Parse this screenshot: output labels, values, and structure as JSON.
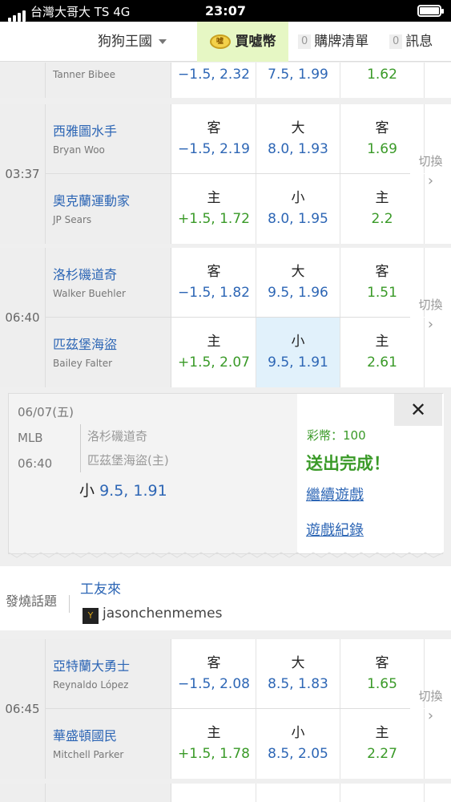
{
  "status": {
    "carrier": "台灣大哥大 TS   4G",
    "time": "23:07"
  },
  "nav": {
    "kingdom": "狗狗王國",
    "buy_label": "買噓幣",
    "coin_glyph": "噓",
    "cart_count": "0",
    "cart_label": "購牌清單",
    "msg_count": "0",
    "msg_label": "訊息"
  },
  "partial_row": {
    "pitcher": "Tanner Bibee",
    "spread": "−1.5, 2.32",
    "total": "7.5, 1.99",
    "ml": "1.62"
  },
  "games": [
    {
      "time": "03:37",
      "switch": "切換",
      "away": {
        "name": "西雅圖水手",
        "pitcher": "Bryan Woo",
        "spread_label": "客",
        "spread": "−1.5, 2.19",
        "total_label": "大",
        "total": "8.0, 1.93",
        "ml_label": "客",
        "ml": "1.69"
      },
      "home": {
        "name": "奧克蘭運動家",
        "pitcher": "JP Sears",
        "spread_label": "主",
        "spread": "+1.5, 1.72",
        "total_label": "小",
        "total": "8.0, 1.95",
        "ml_label": "主",
        "ml": "2.2"
      }
    },
    {
      "time": "06:40",
      "switch": "切換",
      "away": {
        "name": "洛杉磯道奇",
        "pitcher": "Walker Buehler",
        "spread_label": "客",
        "spread": "−1.5, 1.82",
        "total_label": "大",
        "total": "9.5, 1.96",
        "ml_label": "客",
        "ml": "1.51"
      },
      "home": {
        "name": "匹茲堡海盜",
        "pitcher": "Bailey Falter",
        "spread_label": "主",
        "spread": "+1.5, 2.07",
        "total_label": "小",
        "total": "9.5, 1.91",
        "ml_label": "主",
        "ml": "2.61"
      }
    },
    {
      "time": "06:45",
      "switch": "切換",
      "away": {
        "name": "亞特蘭大勇士",
        "pitcher": "Reynaldo López",
        "spread_label": "客",
        "spread": "−1.5, 2.08",
        "total_label": "大",
        "total": "8.5, 1.83",
        "ml_label": "客",
        "ml": "1.65"
      },
      "home": {
        "name": "華盛頓國民",
        "pitcher": "Mitchell Parker",
        "spread_label": "主",
        "spread": "+1.5, 1.78",
        "total_label": "小",
        "total": "8.5, 2.05",
        "ml_label": "主",
        "ml": "2.27"
      }
    }
  ],
  "confirmation": {
    "date": "06/07(五)",
    "league": "MLB",
    "time": "06:40",
    "team1": "洛杉磯道奇",
    "team2": "匹茲堡海盜(主)",
    "pick_label": "小",
    "pick_value": "9.5, 1.91",
    "coins": "彩幣：100",
    "done": "送出完成！",
    "continue": "繼續遊戲",
    "history": "遊戲紀錄",
    "close": "✕"
  },
  "topic": {
    "label": "發燒話題",
    "title": "工友來",
    "avatar_text": "Y",
    "handle": "jasonchenmemes"
  },
  "colors": {
    "green": "#3a9a28",
    "blue": "#2d66b5",
    "selected": "#e1f1fb",
    "buy_bg": "#e6f7c4"
  }
}
